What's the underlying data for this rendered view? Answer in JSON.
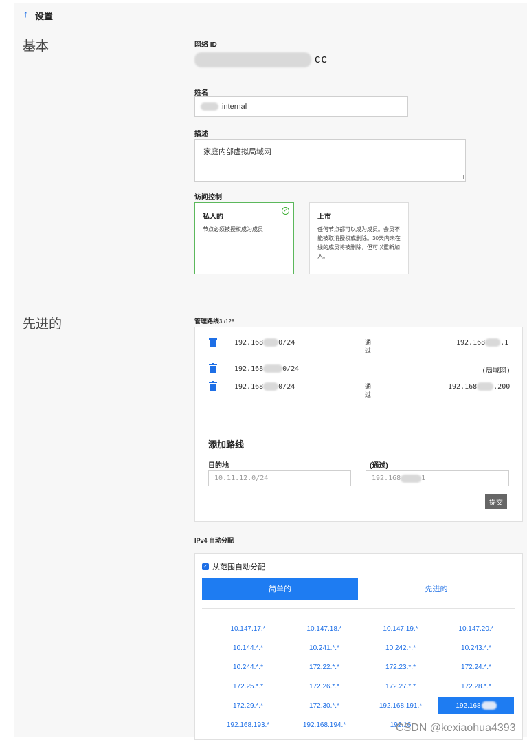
{
  "header": {
    "title": "设置"
  },
  "basic": {
    "section_title": "基本",
    "network_id_label": "网络 ID",
    "network_id_suffix": "cc",
    "name_label": "姓名",
    "name_value": ".internal",
    "description_label": "描述",
    "description_value": "家庭内部虚拟局域网",
    "access_label": "访问控制",
    "private": {
      "title": "私人的",
      "desc": "节点必须被授权成为成员"
    },
    "public": {
      "title": "上市",
      "desc": "任何节点都可以成为成员。会员不能被取消授权或删除。30天内未在线的成员将被删除，但可以重新加入。"
    }
  },
  "advanced": {
    "section_title": "先进的",
    "managed_routes_label": "管理路线",
    "managed_routes_count": "3 /128",
    "routes": [
      {
        "target_a": "192.168",
        "target_b": "0/24",
        "via_label": "通过",
        "gw_a": "192.168",
        "gw_b": ".1"
      },
      {
        "target_a": "192.168",
        "target_b": "0/24",
        "via_label": "",
        "gw_a": "(局域网)",
        "gw_b": ""
      },
      {
        "target_a": "192.168",
        "target_b": "0/24",
        "via_label": "通过",
        "gw_a": "192.168",
        "gw_b": ".200"
      }
    ],
    "add_route": {
      "title": "添加路线",
      "dest_label": "目的地",
      "via_label": "(通过)",
      "dest_placeholder": "10.11.12.0/24",
      "via_value_a": "192.168",
      "via_value_b": "1",
      "submit_label": "提交"
    },
    "ipv4": {
      "label": "IPv4 自动分配",
      "auto_assign_label": "从范围自动分配",
      "tab_simple": "简单的",
      "tab_advanced": "先进的",
      "pools": [
        "10.147.17.*",
        "10.147.18.*",
        "10.147.19.*",
        "10.147.20.*",
        "10.144.*.*",
        "10.241.*.*",
        "10.242.*.*",
        "10.243.*.*",
        "10.244.*.*",
        "172.22.*.*",
        "172.23.*.*",
        "172.24.*.*",
        "172.25.*.*",
        "172.26.*.*",
        "172.27.*.*",
        "172.28.*.*",
        "172.29.*.*",
        "172.30.*.*",
        "192.168.191.*",
        "192.168",
        "192.168.193.*",
        "192.168.194.*",
        "192.16"
      ],
      "selected_index": 19
    }
  },
  "watermark": "CSDN @kexiaohua4393",
  "colors": {
    "accent": "#1e7cf2",
    "selected_border": "#5cb85c"
  }
}
